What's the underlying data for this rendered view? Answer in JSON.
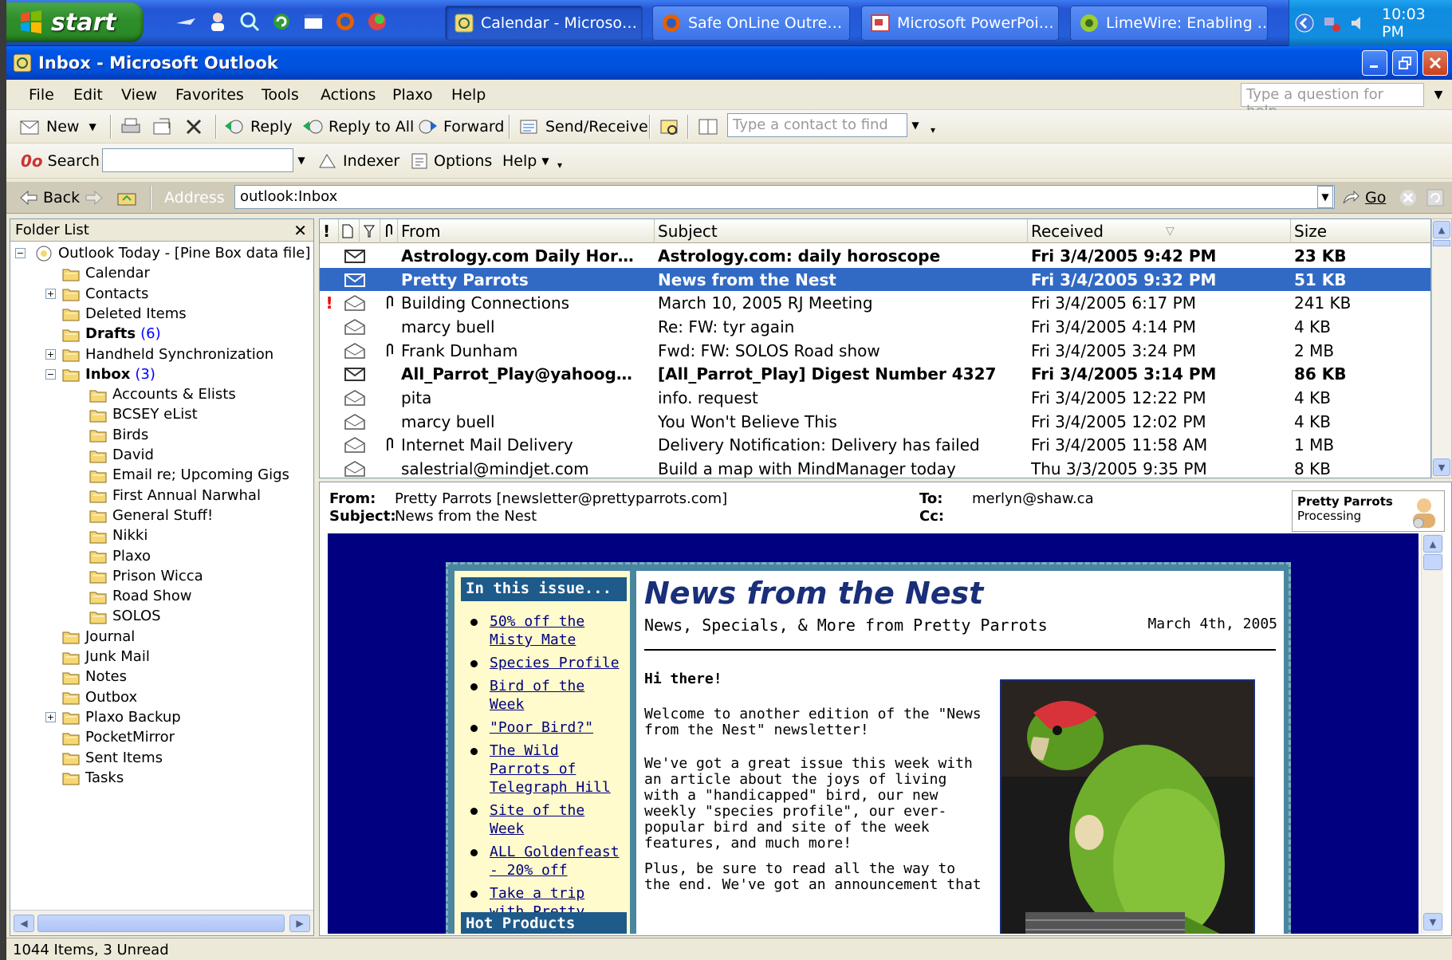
{
  "taskbar": {
    "start_label": "start",
    "tasks": [
      {
        "label": "Calendar - Microso…",
        "icon": "outlook-icon",
        "active": true
      },
      {
        "label": "Safe OnLine Outre…",
        "icon": "firefox-icon",
        "active": false
      },
      {
        "label": "Microsoft PowerPoi…",
        "icon": "powerpoint-icon",
        "active": false
      },
      {
        "label": "LimeWire: Enabling …",
        "icon": "limewire-icon",
        "active": false
      }
    ],
    "clock": "10:03 PM"
  },
  "window": {
    "title": "Inbox - Microsoft Outlook"
  },
  "menu": {
    "items": [
      "File",
      "Edit",
      "View",
      "Favorites",
      "Tools",
      "Actions",
      "Plaxo",
      "Help"
    ],
    "help_placeholder": "Type a question for help"
  },
  "toolbar1": {
    "new_label": "New",
    "reply_label": "Reply",
    "reply_all_label": "Reply to All",
    "forward_label": "Forward",
    "send_receive_label": "Send/Receive",
    "contact_placeholder": "Type a contact to find"
  },
  "toolbar2": {
    "search_label": "Search",
    "indexer_label": "Indexer",
    "options_label": "Options",
    "help_label": "Help"
  },
  "addressbar": {
    "back_label": "Back",
    "address_label": "Address",
    "address_value": "outlook:Inbox",
    "go_label": "Go"
  },
  "folders": {
    "header": "Folder List",
    "items": [
      {
        "name": "Outlook Today - [Pine Box data file]",
        "count": "",
        "level": 0,
        "bold": false
      },
      {
        "name": "Calendar",
        "count": "",
        "level": 1,
        "bold": false
      },
      {
        "name": "Contacts",
        "count": "",
        "level": 1,
        "bold": false
      },
      {
        "name": "Deleted Items",
        "count": "",
        "level": 1,
        "bold": false
      },
      {
        "name": "Drafts",
        "count": "(6)",
        "level": 1,
        "bold": true
      },
      {
        "name": "Handheld Synchronization",
        "count": "",
        "level": 1,
        "bold": false
      },
      {
        "name": "Inbox",
        "count": "(3)",
        "level": 1,
        "bold": true
      },
      {
        "name": "Accounts & Elists",
        "count": "",
        "level": 2,
        "bold": false
      },
      {
        "name": "BCSEY eList",
        "count": "",
        "level": 2,
        "bold": false
      },
      {
        "name": "Birds",
        "count": "",
        "level": 2,
        "bold": false
      },
      {
        "name": "David",
        "count": "",
        "level": 2,
        "bold": false
      },
      {
        "name": "Email re; Upcoming Gigs",
        "count": "",
        "level": 2,
        "bold": false
      },
      {
        "name": "First Annual Narwhal",
        "count": "",
        "level": 2,
        "bold": false
      },
      {
        "name": "General Stuff!",
        "count": "",
        "level": 2,
        "bold": false
      },
      {
        "name": "Nikki",
        "count": "",
        "level": 2,
        "bold": false
      },
      {
        "name": "Plaxo",
        "count": "",
        "level": 2,
        "bold": false
      },
      {
        "name": "Prison Wicca",
        "count": "",
        "level": 2,
        "bold": false
      },
      {
        "name": "Road Show",
        "count": "",
        "level": 2,
        "bold": false
      },
      {
        "name": "SOLOS",
        "count": "",
        "level": 2,
        "bold": false
      },
      {
        "name": "Journal",
        "count": "",
        "level": 1,
        "bold": false
      },
      {
        "name": "Junk Mail",
        "count": "",
        "level": 1,
        "bold": false
      },
      {
        "name": "Notes",
        "count": "",
        "level": 1,
        "bold": false
      },
      {
        "name": "Outbox",
        "count": "",
        "level": 1,
        "bold": false
      },
      {
        "name": "Plaxo Backup",
        "count": "",
        "level": 1,
        "bold": false
      },
      {
        "name": "PocketMirror",
        "count": "",
        "level": 1,
        "bold": false
      },
      {
        "name": "Sent Items",
        "count": "",
        "level": 1,
        "bold": false
      },
      {
        "name": "Tasks",
        "count": "",
        "level": 1,
        "bold": false
      }
    ]
  },
  "messages": {
    "columns": [
      "!",
      "",
      "",
      "",
      "From",
      "Subject",
      "Received",
      "Size"
    ],
    "rows": [
      {
        "from": "Astrology.com Daily Hor…",
        "subject": "Astrology.com: daily horoscope",
        "received": "Fri 3/4/2005 9:42 PM",
        "size": "23 KB",
        "unread": true,
        "selected": false,
        "important": false,
        "attach": false
      },
      {
        "from": "Pretty Parrots",
        "subject": "News from the Nest",
        "received": "Fri 3/4/2005 9:32 PM",
        "size": "51 KB",
        "unread": true,
        "selected": true,
        "important": false,
        "attach": false
      },
      {
        "from": "Building Connections",
        "subject": "March 10, 2005 RJ Meeting",
        "received": "Fri 3/4/2005 6:17 PM",
        "size": "241 KB",
        "unread": false,
        "selected": false,
        "important": true,
        "attach": true
      },
      {
        "from": "marcy buell",
        "subject": "Re: FW: tyr again",
        "received": "Fri 3/4/2005 4:14 PM",
        "size": "4 KB",
        "unread": false,
        "selected": false,
        "important": false,
        "attach": false
      },
      {
        "from": "Frank Dunham",
        "subject": "Fwd: FW: SOLOS Road show",
        "received": "Fri 3/4/2005 3:24 PM",
        "size": "2 MB",
        "unread": false,
        "selected": false,
        "important": false,
        "attach": true
      },
      {
        "from": "All_Parrot_Play@yahoog…",
        "subject": "[All_Parrot_Play] Digest Number 4327",
        "received": "Fri 3/4/2005 3:14 PM",
        "size": "86 KB",
        "unread": true,
        "selected": false,
        "important": false,
        "attach": false
      },
      {
        "from": "pita",
        "subject": "info. request",
        "received": "Fri 3/4/2005 12:22 PM",
        "size": "4 KB",
        "unread": false,
        "selected": false,
        "important": false,
        "attach": false
      },
      {
        "from": "marcy buell",
        "subject": "You Won't Believe This",
        "received": "Fri 3/4/2005 12:02 PM",
        "size": "4 KB",
        "unread": false,
        "selected": false,
        "important": false,
        "attach": false
      },
      {
        "from": "Internet Mail Delivery",
        "subject": "Delivery Notification: Delivery has failed",
        "received": "Fri 3/4/2005 11:58 AM",
        "size": "1 MB",
        "unread": false,
        "selected": false,
        "important": false,
        "attach": true
      },
      {
        "from": "salestrial@mindjet.com",
        "subject": "Build a map with MindManager today",
        "received": "Thu 3/3/2005 9:35 PM",
        "size": "8 KB",
        "unread": false,
        "selected": false,
        "important": false,
        "attach": false
      }
    ]
  },
  "preview": {
    "from_label": "From:",
    "from_value": "Pretty Parrots [newsletter@prettyparrots.com]",
    "subject_label": "Subject:",
    "subject_value": "News from the Nest",
    "to_label": "To:",
    "to_value": "merlyn@shaw.ca",
    "cc_label": "Cc:",
    "contact_name": "Pretty Parrots",
    "contact_status": "Processing",
    "newsletter": {
      "issue_header": "In this issue...",
      "issue_links": [
        "50% off the Misty Mate",
        "Species Profile",
        "Bird of the Week",
        "\"Poor Bird?\"",
        "The Wild Parrots of Telegraph Hill",
        "Site of the Week",
        "ALL Goldenfeast - 20% off",
        "Take a trip with Pretty Parrots"
      ],
      "hot_products": "Hot Products",
      "title": "News from the Nest",
      "subtitle": "News, Specials, & More from Pretty Parrots",
      "date": "March 4th, 2005",
      "greeting": "Hi there!",
      "para1": "Welcome to another edition of the \"News from the Nest\" newsletter!",
      "para2": "We've got a great issue this week with an article about the joys of living with a \"handicapped\" bird, our new weekly \"species profile\", our ever-popular bird and site of the week features, and much more!",
      "para3": "Plus, be sure to read all the way to the end. We've got an announcement that"
    }
  },
  "status": {
    "text": "1044 Items, 3 Unread"
  }
}
